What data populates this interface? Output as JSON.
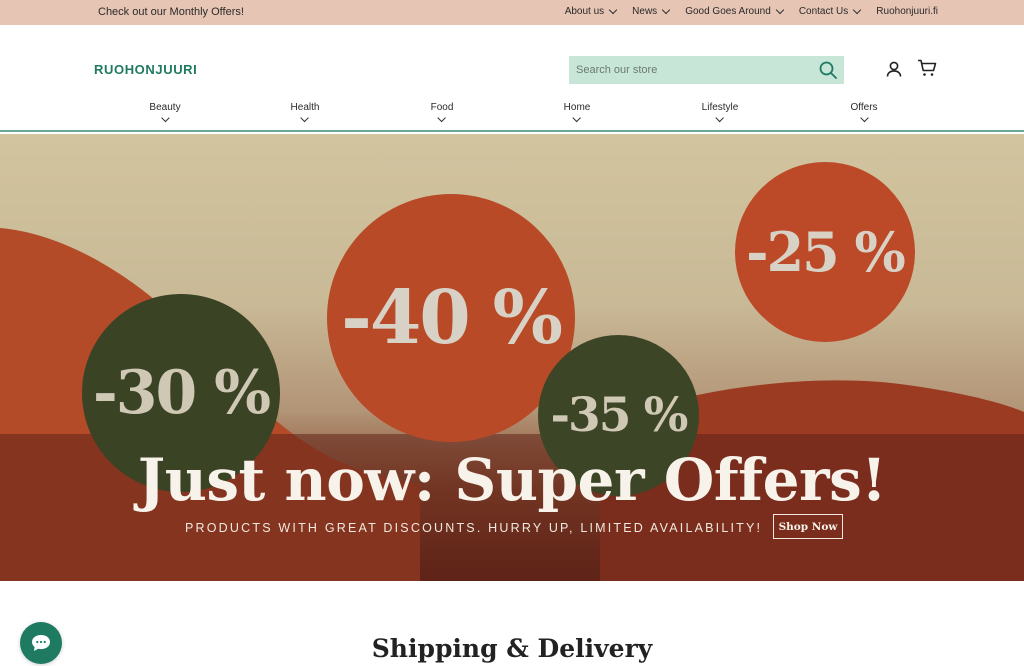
{
  "topbar": {
    "promo": "Check out our Monthly Offers!",
    "links": [
      {
        "label": "About us",
        "dropdown": true
      },
      {
        "label": "News",
        "dropdown": true
      },
      {
        "label": "Good Goes Around",
        "dropdown": true
      },
      {
        "label": "Contact Us",
        "dropdown": true
      },
      {
        "label": "Ruohonjuuri.fi",
        "dropdown": false
      }
    ]
  },
  "header": {
    "logo": "RUOHONJUURI",
    "search_placeholder": "Search our store",
    "icons": [
      "search-icon",
      "account-icon",
      "cart-icon"
    ]
  },
  "nav": {
    "items": [
      {
        "label": "Beauty"
      },
      {
        "label": "Health"
      },
      {
        "label": "Food"
      },
      {
        "label": "Home"
      },
      {
        "label": "Lifestyle"
      },
      {
        "label": "Offers"
      }
    ]
  },
  "hero": {
    "badges": [
      "-30 %",
      "-40 %",
      "-25 %",
      "-35 %"
    ],
    "headline": "Just now: Super Offers!",
    "subline": "PRODUCTS WITH GREAT DISCOUNTS. HURRY UP, LIMITED AVAILABILITY!",
    "cta": "Shop Now",
    "colors": {
      "terracotta": "#b94a27",
      "olive": "#3b4325",
      "sand": "#d2c49f"
    }
  },
  "section": {
    "title": "Shipping & Delivery"
  },
  "chat": {
    "icon": "chat-bubble-icon"
  }
}
